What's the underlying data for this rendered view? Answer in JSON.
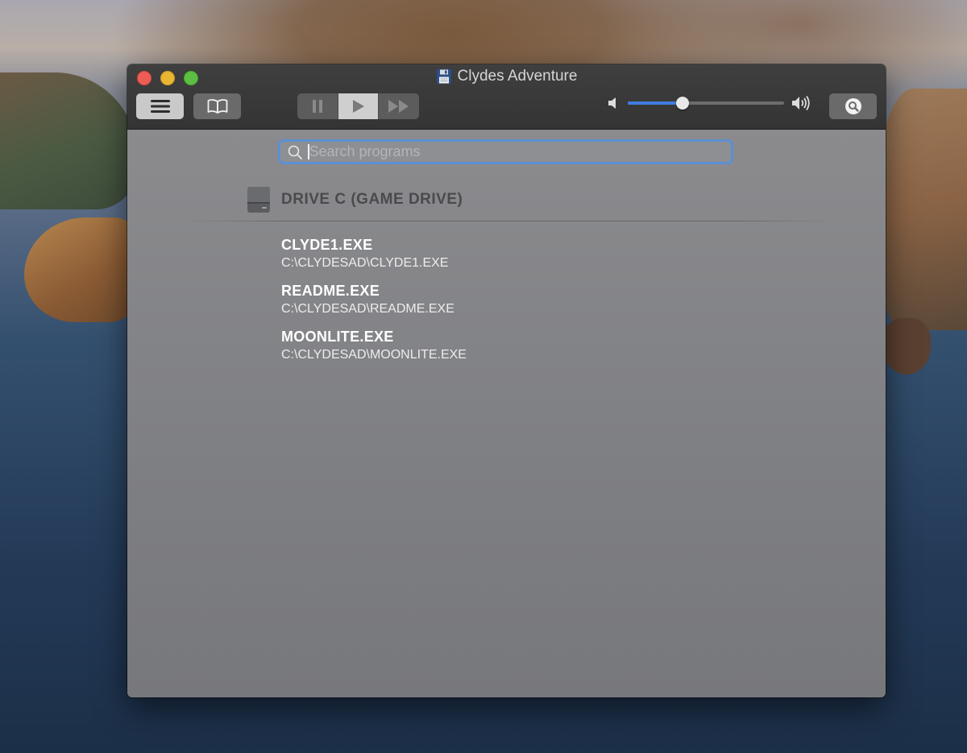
{
  "window": {
    "title": "Clydes Adventure"
  },
  "toolbar": {
    "list_button_icon": "list-icon",
    "docs_button_icon": "book-icon",
    "transport": [
      "pause-icon",
      "play-icon",
      "fast-forward-icon"
    ],
    "volume_level": 0.35,
    "search_button_icon": "magnifier-icon"
  },
  "search": {
    "placeholder": "Search programs",
    "value": ""
  },
  "drive": {
    "label": "DRIVE C (GAME DRIVE)"
  },
  "programs": [
    {
      "name": "CLYDE1.EXE",
      "path": "C:\\CLYDESAD\\CLYDE1.EXE"
    },
    {
      "name": "README.EXE",
      "path": "C:\\CLYDESAD\\README.EXE"
    },
    {
      "name": "MOONLITE.EXE",
      "path": "C:\\CLYDESAD\\MOONLITE.EXE"
    }
  ],
  "colors": {
    "accent": "#3f7de0",
    "search_focus_ring": "#5d8fd4",
    "close": "#ee5d55",
    "minimize": "#e9b632",
    "zoom": "#5cbe43"
  }
}
